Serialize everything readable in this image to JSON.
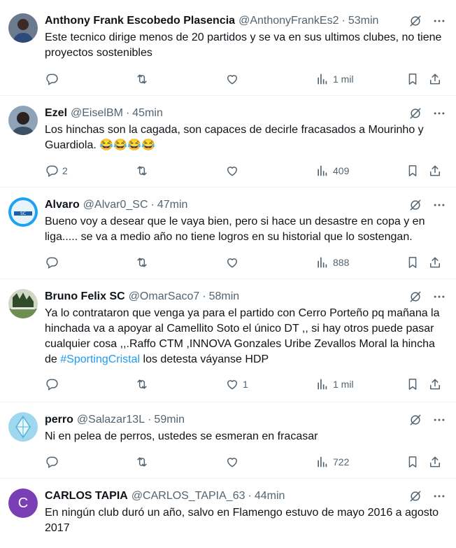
{
  "colors": {
    "text": "#0f1419",
    "muted": "#536471",
    "accent": "#1d9bf0",
    "border": "#eff3f4"
  },
  "tweets": [
    {
      "name": "Anthony Frank Escobedo Plasencia",
      "handle": "@AnthonyFrankEs2",
      "time": "53min",
      "text": "Este tecnico dirige menos de 20 partidos y se va en sus ultimos clubes, no tiene proyectos sostenibles",
      "replies": "",
      "likes": "",
      "views": "1 mil",
      "avatar_icon": "person-photo"
    },
    {
      "name": "Ezel",
      "handle": "@EiselBM",
      "time": "45min",
      "text": "Los hinchas son la cagada, son capaces de decirle fracasados a Mourinho y Guardiola. 😂😂😂😂",
      "replies": "2",
      "likes": "",
      "views": "409",
      "avatar_icon": "person-photo"
    },
    {
      "name": "Alvaro",
      "handle": "@Alvar0_SC",
      "time": "47min",
      "text": "Bueno voy a desear que le vaya bien, pero si hace un desastre en copa y en liga..... se va a medio año no tiene logros en su historial que lo sostengan.",
      "replies": "",
      "likes": "",
      "views": "888",
      "avatar_icon": "club-crest"
    },
    {
      "name": "Bruno Felix SC",
      "handle": "@OmarSaco7",
      "time": "58min",
      "text_before": "Ya lo contrataron que venga ya para el partido con Cerro Porteño pq mañana la hinchada va a apoyar al Camellito Soto el único DT ,, si hay otros puede pasar cualquier cosa ,,.Raffo CTM ,INNOVA Gonzales Uribe Zevallos Moral la hincha de ",
      "hashtag": "#SportingCristal",
      "text_after": " los detesta váyanse HDP",
      "replies": "",
      "likes": "1",
      "views": "1 mil",
      "avatar_icon": "stadium-photo"
    },
    {
      "name": "perro",
      "handle": "@Salazar13L",
      "time": "59min",
      "text": "Ni en pelea de perros, ustedes se esmeran en fracasar",
      "replies": "",
      "likes": "",
      "views": "722",
      "avatar_icon": "crystal-photo"
    },
    {
      "name": "CARLOS TAPIA",
      "handle": "@CARLOS_TAPIA_63",
      "time": "44min",
      "text": "En ningún club duró un año, salvo en Flamengo estuvo de mayo 2016 a agosto 2017",
      "avatar_letter": "C",
      "avatar_color": "#7b3fb5"
    }
  ]
}
